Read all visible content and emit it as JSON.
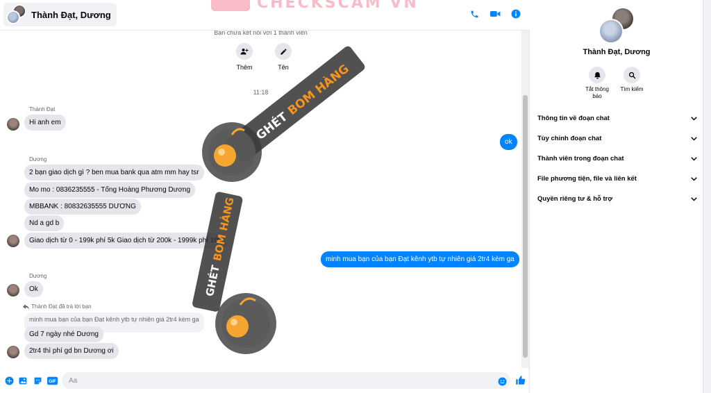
{
  "header": {
    "name": "Thành Đạt, Dương",
    "watermark_text": "CHECKSCAM VN",
    "actions": [
      "phone-icon",
      "video-icon",
      "info-icon"
    ],
    "accent_color": "#0084ff"
  },
  "thread": {
    "connect_note": "Bạn chưa kết nối với 1 thành viên",
    "quick_actions": [
      {
        "label": "Thêm",
        "icon": "add-person-icon"
      },
      {
        "label": "Tên",
        "icon": "pencil-icon"
      }
    ],
    "timestamp": "11:18",
    "messages": [
      {
        "sender": "Thành Đạt",
        "text": "Hi anh em",
        "dir": "in"
      },
      {
        "text": "ok",
        "dir": "out"
      },
      {
        "sender": "Dương",
        "text": "2 bạn giao dịch gì ? ben mua bank qua atm mm hay tsr",
        "dir": "in"
      },
      {
        "text": "Mo mo :  0836235555 - Tống Hoàng Phương Dương",
        "dir": "in"
      },
      {
        "text": "MBBANK : 80832635555 DƯƠNG",
        "dir": "in"
      },
      {
        "text": "Nd a gd b",
        "dir": "in"
      },
      {
        "text": "Giao dịch từ 0 - 199k phí 5k  Giao dịch từ 200k - 1999k phí 10k",
        "dir": "in"
      },
      {
        "text": "minh mua bạn của bạn Đạt kênh ytb tự nhiên giá 2tr4 kèm ga",
        "dir": "out"
      },
      {
        "sender": "Dương",
        "text": "Ok",
        "dir": "in"
      },
      {
        "reply_note": "Thành Đạt đã trả lời bạn",
        "quoted": "minh mua bạn của bạn Đạt kênh ytb tự nhiên giá 2tr4 kèm ga",
        "text": "Gd 7 ngày nhé Dương",
        "dir": "in"
      },
      {
        "text": "2tr4 thì phí gd bn Dương ơi",
        "dir": "in"
      }
    ],
    "stamp_text": {
      "part1": "GHÉT",
      "part2": "BOM HÀNG"
    }
  },
  "composer": {
    "placeholder": "Aa",
    "icons": [
      "plus-icon",
      "image-icon",
      "sticker-icon",
      "gif-icon",
      "emoji-icon",
      "like-icon"
    ],
    "gif_label": "GIF"
  },
  "info_panel": {
    "name": "Thành Đạt, Dương",
    "actions": [
      {
        "label": "Tắt thông báo",
        "icon": "bell-icon"
      },
      {
        "label": "Tìm kiếm",
        "icon": "search-icon"
      }
    ],
    "menu": [
      "Thông tin về đoạn chat",
      "Tùy chỉnh đoạn chat",
      "Thành viên trong đoạn chat",
      "File phương tiện, file và liên kết",
      "Quyền riêng tư & hỗ trợ"
    ]
  }
}
